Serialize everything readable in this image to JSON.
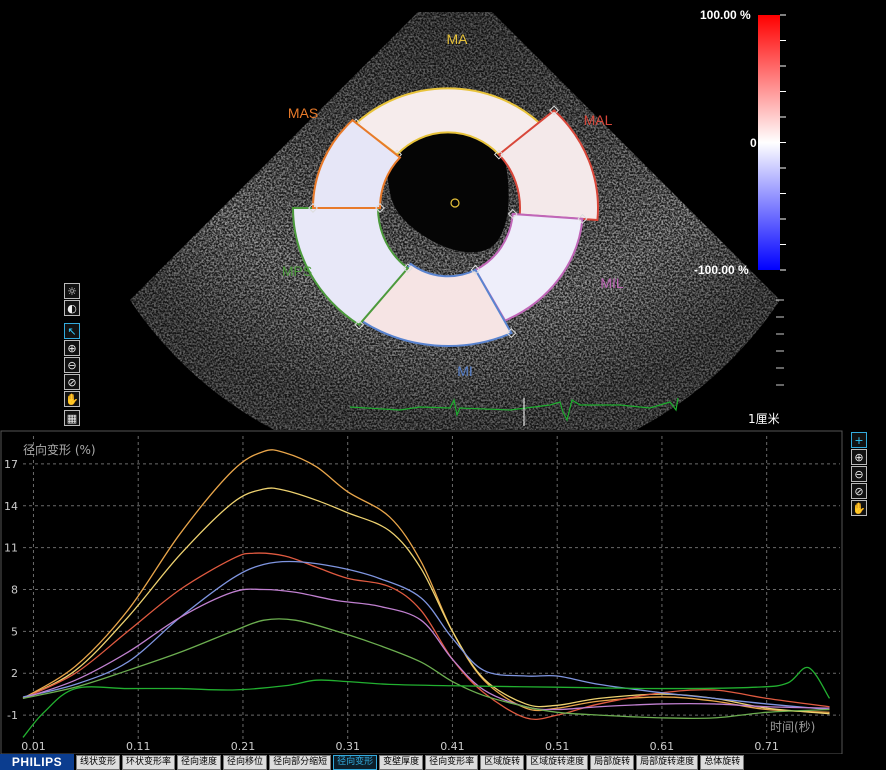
{
  "echo": {
    "segments": [
      {
        "label": "MA",
        "color": "#e8c33a"
      },
      {
        "label": "MAL",
        "color": "#d8473a"
      },
      {
        "label": "MIL",
        "color": "#c066b8"
      },
      {
        "label": "MI",
        "color": "#5a84d0"
      },
      {
        "label": "MPS",
        "color": "#4c9a3c"
      },
      {
        "label": "MAS",
        "color": "#e87a2a"
      }
    ],
    "colorbar": {
      "max_label": "100.00 %",
      "mid_label": "0",
      "min_label": "-100.00 %"
    },
    "scale_label": "1厘米"
  },
  "toolbar_left": [
    {
      "icon": "brightness-icon"
    },
    {
      "icon": "contrast-icon"
    },
    {
      "icon": "pointer-icon"
    },
    {
      "icon": "zoom-in-icon"
    },
    {
      "icon": "zoom-out-icon"
    },
    {
      "icon": "zoom-reset-icon"
    },
    {
      "icon": "hand-pan-icon"
    },
    {
      "icon": "grid-icon"
    }
  ],
  "toolbar_right": [
    {
      "icon": "crosshair-icon"
    },
    {
      "icon": "zoom-in-icon"
    },
    {
      "icon": "zoom-out-icon"
    },
    {
      "icon": "zoom-reset-icon"
    },
    {
      "icon": "hand-pan-icon"
    }
  ],
  "plot": {
    "title": "径向变形 (%)",
    "x_axis_label": "时间(秒)"
  },
  "chart_data": {
    "type": "line",
    "title": "径向变形 (%)",
    "xlabel": "时间(秒)",
    "ylabel": "",
    "x_ticks": [
      0.01,
      0.11,
      0.21,
      0.31,
      0.41,
      0.51,
      0.61,
      0.71
    ],
    "y_ticks": [
      -1,
      2,
      5,
      8,
      11,
      14,
      17
    ],
    "xlim": [
      0.0,
      0.78
    ],
    "ylim": [
      -3,
      19
    ],
    "grid": true,
    "series": [
      {
        "color": "#e8a54a",
        "x": [
          0.0,
          0.05,
          0.1,
          0.15,
          0.2,
          0.23,
          0.25,
          0.28,
          0.31,
          0.35,
          0.38,
          0.41,
          0.44,
          0.48,
          0.51,
          0.55,
          0.61,
          0.66,
          0.71,
          0.77
        ],
        "y": [
          0.2,
          2.5,
          6.5,
          12,
          16.5,
          17.9,
          17.8,
          16.8,
          15,
          13.2,
          10,
          5,
          1.5,
          -0.5,
          -0.5,
          0,
          0.3,
          0,
          -0.6,
          -0.8
        ]
      },
      {
        "color": "#eed270",
        "x": [
          0.0,
          0.05,
          0.1,
          0.15,
          0.2,
          0.23,
          0.25,
          0.28,
          0.31,
          0.35,
          0.38,
          0.41,
          0.44,
          0.48,
          0.51,
          0.55,
          0.61,
          0.66,
          0.71,
          0.77
        ],
        "y": [
          0.2,
          2.2,
          6,
          10.5,
          14.2,
          15.2,
          15.1,
          14.4,
          13.5,
          12.2,
          9.5,
          5,
          1.6,
          -0.2,
          -0.3,
          0.2,
          0.5,
          0.2,
          -0.5,
          -0.9
        ]
      },
      {
        "color": "#e05a40",
        "x": [
          0.0,
          0.05,
          0.1,
          0.15,
          0.2,
          0.22,
          0.25,
          0.28,
          0.31,
          0.35,
          0.38,
          0.41,
          0.44,
          0.48,
          0.51,
          0.55,
          0.61,
          0.66,
          0.71,
          0.77
        ],
        "y": [
          0.2,
          2,
          5,
          8,
          10.2,
          10.6,
          10.4,
          9.6,
          8.8,
          8.2,
          6.5,
          3,
          0.6,
          -1.2,
          -1,
          -0.2,
          0.6,
          0.8,
          0.2,
          -0.4
        ]
      },
      {
        "color": "#7f95e0",
        "x": [
          0.0,
          0.05,
          0.1,
          0.15,
          0.2,
          0.23,
          0.26,
          0.3,
          0.34,
          0.38,
          0.41,
          0.44,
          0.48,
          0.51,
          0.55,
          0.61,
          0.66,
          0.71,
          0.77
        ],
        "y": [
          0.3,
          1.2,
          2.8,
          6,
          8.8,
          9.8,
          10,
          9.6,
          8.8,
          7.4,
          4.5,
          2.2,
          1.8,
          1.8,
          1.2,
          0.6,
          0.2,
          -0.2,
          -0.6
        ]
      },
      {
        "color": "#c080d0",
        "x": [
          0.0,
          0.05,
          0.1,
          0.15,
          0.2,
          0.23,
          0.26,
          0.3,
          0.34,
          0.38,
          0.41,
          0.44,
          0.48,
          0.51,
          0.55,
          0.61,
          0.66,
          0.71,
          0.77
        ],
        "y": [
          0.2,
          1.5,
          3.5,
          6,
          7.8,
          8,
          7.8,
          7.2,
          6.8,
          5.8,
          3,
          0.8,
          -0.4,
          -0.6,
          -0.4,
          -0.2,
          -0.2,
          -0.4,
          -0.5
        ]
      },
      {
        "color": "#6cae50",
        "x": [
          0.0,
          0.05,
          0.1,
          0.15,
          0.2,
          0.23,
          0.26,
          0.3,
          0.34,
          0.38,
          0.41,
          0.44,
          0.48,
          0.51,
          0.55,
          0.61,
          0.66,
          0.71,
          0.77
        ],
        "y": [
          0.2,
          1,
          2.2,
          3.5,
          5,
          5.8,
          5.8,
          5,
          4,
          2.8,
          1.4,
          0.4,
          -0.4,
          -0.8,
          -1,
          -1.2,
          -1.2,
          -0.8,
          -0.6
        ]
      },
      {
        "color": "#22b030",
        "x": [
          0.0,
          0.02,
          0.05,
          0.1,
          0.15,
          0.2,
          0.25,
          0.28,
          0.31,
          0.35,
          0.41,
          0.51,
          0.61,
          0.7,
          0.73,
          0.75,
          0.77
        ],
        "y": [
          -2.6,
          -0.8,
          0.9,
          0.9,
          0.9,
          0.8,
          1.1,
          1.5,
          1.4,
          1.2,
          1.1,
          1,
          0.9,
          1,
          1.3,
          2.4,
          0.2
        ]
      }
    ]
  },
  "tabs": [
    {
      "label": "线状变形"
    },
    {
      "label": "环状变形率"
    },
    {
      "label": "径向速度"
    },
    {
      "label": "径向移位"
    },
    {
      "label": "径向部分缩短"
    },
    {
      "label": "径向变形",
      "active": true
    },
    {
      "label": "变壁厚度"
    },
    {
      "label": "径向变形率"
    },
    {
      "label": "区域旋转"
    },
    {
      "label": "区域旋转速度"
    },
    {
      "label": "局部旋转"
    },
    {
      "label": "局部旋转速度"
    },
    {
      "label": "总体旋转"
    }
  ],
  "logo": "PHILIPS"
}
